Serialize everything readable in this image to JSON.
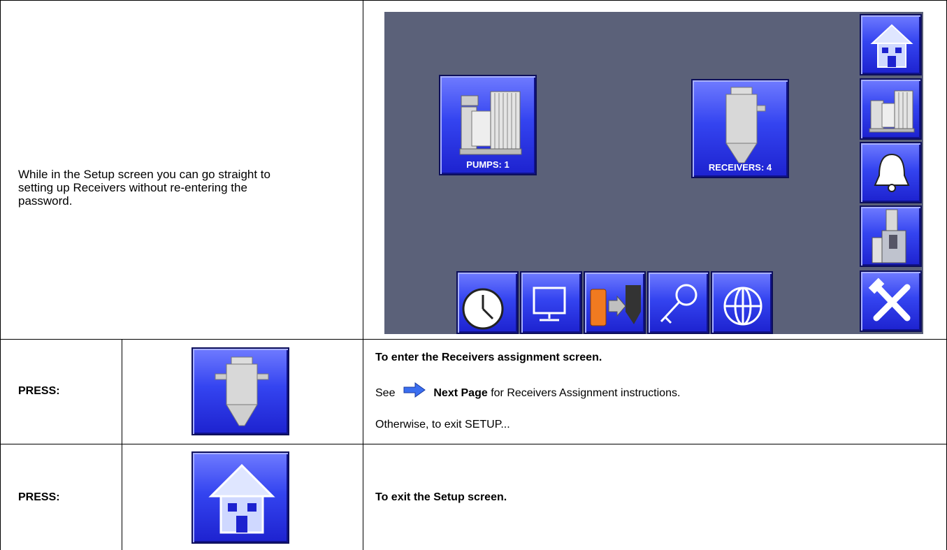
{
  "intro": {
    "line1": "While in the Setup screen you can go straight to",
    "line2": "setting up Receivers without re-entering the",
    "line3": "password."
  },
  "screen": {
    "pumps_label": "PUMPS: 1",
    "receivers_label": "RECEIVERS: 4",
    "side_buttons": [
      "home-icon",
      "pump-icon",
      "alarm-bell-icon",
      "receiver-station-icon",
      "tools-icon"
    ],
    "bottom_buttons": [
      "clock-icon",
      "monitor-icon",
      "usb-transfer-icon",
      "key-icon",
      "globe-icon"
    ]
  },
  "rows": [
    {
      "label": "PRESS:",
      "heading": "To enter the Receivers assignment screen.",
      "see_prefix": "See",
      "see_link": "Next Page",
      "see_suffix": "for Receivers Assignment instructions.",
      "otherwise": "Otherwise, to exit SETUP..."
    },
    {
      "label": "PRESS:",
      "heading": "To exit the Setup screen."
    }
  ],
  "colors": {
    "screen_bg": "#5b6179",
    "button_blue": "#3444f0",
    "arrow_blue": "#3a6ef0"
  }
}
